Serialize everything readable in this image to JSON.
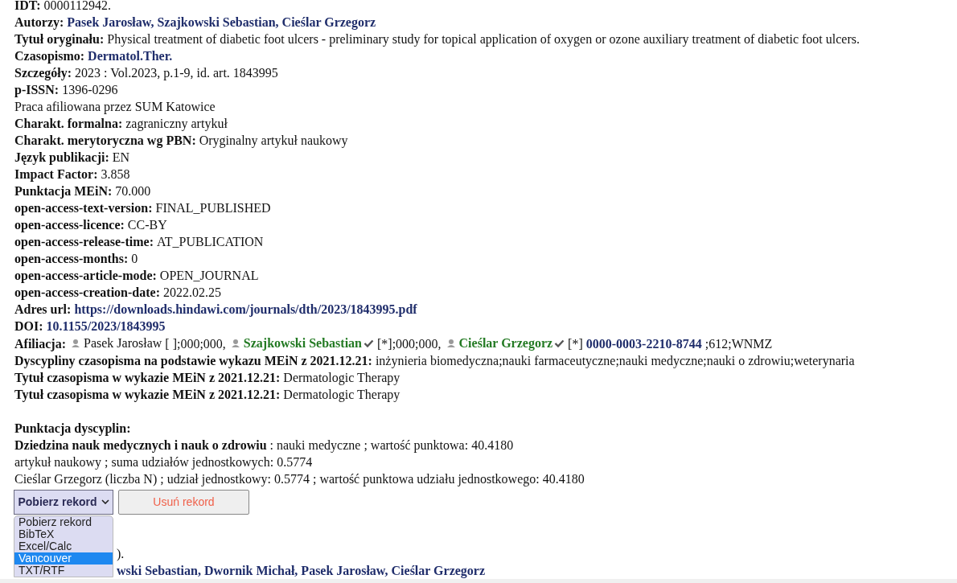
{
  "record": [
    {
      "parts": [
        {
          "kind": "label",
          "text": "IDT:"
        },
        {
          "kind": "text",
          "text": "0000112942."
        }
      ]
    },
    {
      "parts": [
        {
          "kind": "label",
          "text": "Autorzy:"
        },
        {
          "kind": "link",
          "text": "Pasek Jarosław, Szajkowski Sebastian, Cieślar Grzegorz"
        }
      ]
    },
    {
      "parts": [
        {
          "kind": "label",
          "text": "Tytuł oryginału:"
        },
        {
          "kind": "text",
          "text": "Physical treatment of diabetic foot ulcers - preliminary study for topical application of oxygen or ozone auxiliary treatment of diabetic foot ulcers."
        }
      ]
    },
    {
      "parts": [
        {
          "kind": "label",
          "text": "Czasopismo:"
        },
        {
          "kind": "link",
          "text": "Dermatol.Ther."
        }
      ]
    },
    {
      "parts": [
        {
          "kind": "label",
          "text": "Szczegóły:"
        },
        {
          "kind": "text",
          "text": "2023 : Vol.2023, p.1-9, id. art. 1843995"
        }
      ]
    },
    {
      "parts": [
        {
          "kind": "label",
          "text": "p-ISSN:"
        },
        {
          "kind": "text",
          "text": "1396-0296"
        }
      ]
    },
    {
      "parts": [
        {
          "kind": "text",
          "text": "Praca afiliowana przez SUM Katowice"
        }
      ]
    },
    {
      "parts": [
        {
          "kind": "label",
          "text": "Charakt. formalna:"
        },
        {
          "kind": "text",
          "text": "zagraniczny artykuł"
        }
      ]
    },
    {
      "parts": [
        {
          "kind": "label",
          "text": "Charakt. merytoryczna wg PBN:"
        },
        {
          "kind": "text",
          "text": "Oryginalny artykuł naukowy"
        }
      ]
    },
    {
      "parts": [
        {
          "kind": "label",
          "text": "Język publikacji:"
        },
        {
          "kind": "text",
          "text": "EN"
        }
      ]
    },
    {
      "parts": [
        {
          "kind": "label",
          "text": "Impact Factor:"
        },
        {
          "kind": "text",
          "text": "3.858"
        }
      ]
    },
    {
      "parts": [
        {
          "kind": "label",
          "text": "Punktacja MEiN:"
        },
        {
          "kind": "text",
          "text": "70.000"
        }
      ]
    },
    {
      "parts": [
        {
          "kind": "label",
          "text": "open-access-text-version:"
        },
        {
          "kind": "text",
          "text": "FINAL_PUBLISHED"
        }
      ]
    },
    {
      "parts": [
        {
          "kind": "label",
          "text": "open-access-licence:"
        },
        {
          "kind": "text",
          "text": "CC-BY"
        }
      ]
    },
    {
      "parts": [
        {
          "kind": "label",
          "text": "open-access-release-time:"
        },
        {
          "kind": "text",
          "text": "AT_PUBLICATION"
        }
      ]
    },
    {
      "parts": [
        {
          "kind": "label",
          "text": "open-access-months:"
        },
        {
          "kind": "text",
          "text": "0"
        }
      ]
    },
    {
      "parts": [
        {
          "kind": "label",
          "text": "open-access-article-mode:"
        },
        {
          "kind": "text",
          "text": "OPEN_JOURNAL"
        }
      ]
    },
    {
      "parts": [
        {
          "kind": "label",
          "text": "open-access-creation-date:"
        },
        {
          "kind": "text",
          "text": "2022.02.25"
        }
      ]
    },
    {
      "parts": [
        {
          "kind": "label",
          "text": "Adres url:"
        },
        {
          "kind": "link",
          "text": "https://downloads.hindawi.com/journals/dth/2023/1843995.pdf"
        }
      ]
    },
    {
      "parts": [
        {
          "kind": "label",
          "text": "DOI:"
        },
        {
          "kind": "link",
          "text": "10.1155/2023/1843995"
        }
      ]
    },
    {
      "parts": [
        {
          "kind": "label",
          "text": "Afiliacja:"
        },
        {
          "kind": "author",
          "text": "Pasek Jarosław",
          "verified": false
        },
        {
          "kind": "text",
          "text": "[ ];000;000,"
        },
        {
          "kind": "author",
          "text": "Szajkowski Sebastian",
          "verified": true
        },
        {
          "kind": "text",
          "text": "[*];000;000,"
        },
        {
          "kind": "author",
          "text": "Cieślar Grzegorz",
          "verified": true
        },
        {
          "kind": "text",
          "text": "[*]"
        },
        {
          "kind": "link",
          "text": "0000-0003-2210-8744"
        },
        {
          "kind": "text",
          "text": ";612;WNMZ"
        }
      ]
    },
    {
      "parts": [
        {
          "kind": "label",
          "text": "Dyscypliny czasopisma na podstawie wykazu MEiN z 2021.12.21:"
        },
        {
          "kind": "text",
          "text": "inżynieria biomedyczna;nauki farmaceutyczne;nauki medyczne;nauki o zdrowiu;weterynaria"
        }
      ]
    },
    {
      "parts": [
        {
          "kind": "label",
          "text": "Tytuł czasopisma w wykazie MEiN z 2021.12.21:"
        },
        {
          "kind": "text",
          "text": "Dermatologic Therapy"
        }
      ]
    },
    {
      "parts": [
        {
          "kind": "label",
          "text": "Tytuł czasopisma w wykazie MEiN z 2021.12.21:"
        },
        {
          "kind": "text",
          "text": "Dermatologic Therapy"
        }
      ]
    }
  ],
  "scoring": [
    {
      "parts": [
        {
          "kind": "label",
          "text": "Punktacja dyscyplin:"
        }
      ]
    },
    {
      "parts": [
        {
          "kind": "label",
          "text": "Dziedzina nauk medycznych i nauk o zdrowiu"
        },
        {
          "kind": "text",
          "text": ": nauki medyczne ; wartość punktowa: 40.4180"
        }
      ]
    },
    {
      "parts": [
        {
          "kind": "text",
          "text": "artykuł naukowy ; suma udziałów jednostkowych: 0.5774"
        }
      ]
    },
    {
      "parts": [
        {
          "kind": "text",
          "text": "Cieślar Grzegorz (liczba N) ; udział jednostkowy: 0.5774 ; wartość punktowa udziału jednostkowego: 40.4180"
        }
      ]
    }
  ],
  "actions": {
    "select": "Pobierz rekord",
    "delete": "Usuń rekord"
  },
  "dropdown": [
    {
      "label": "Pobierz rekord",
      "selected": false
    },
    {
      "label": "BibTeX",
      "selected": false
    },
    {
      "label": "Excel/Calc",
      "selected": false
    },
    {
      "label": "Vancouver",
      "selected": true
    },
    {
      "label": "TXT/RTF",
      "selected": false
    }
  ],
  "next_record": [
    {
      "parts": [
        {
          "kind": "text",
          "text": ")."
        }
      ]
    },
    {
      "parts": [
        {
          "kind": "link",
          "text": "wski Sebastian, Dwornik Michał, Pasek Jarosław, Cieślar Grzegorz"
        }
      ]
    }
  ]
}
